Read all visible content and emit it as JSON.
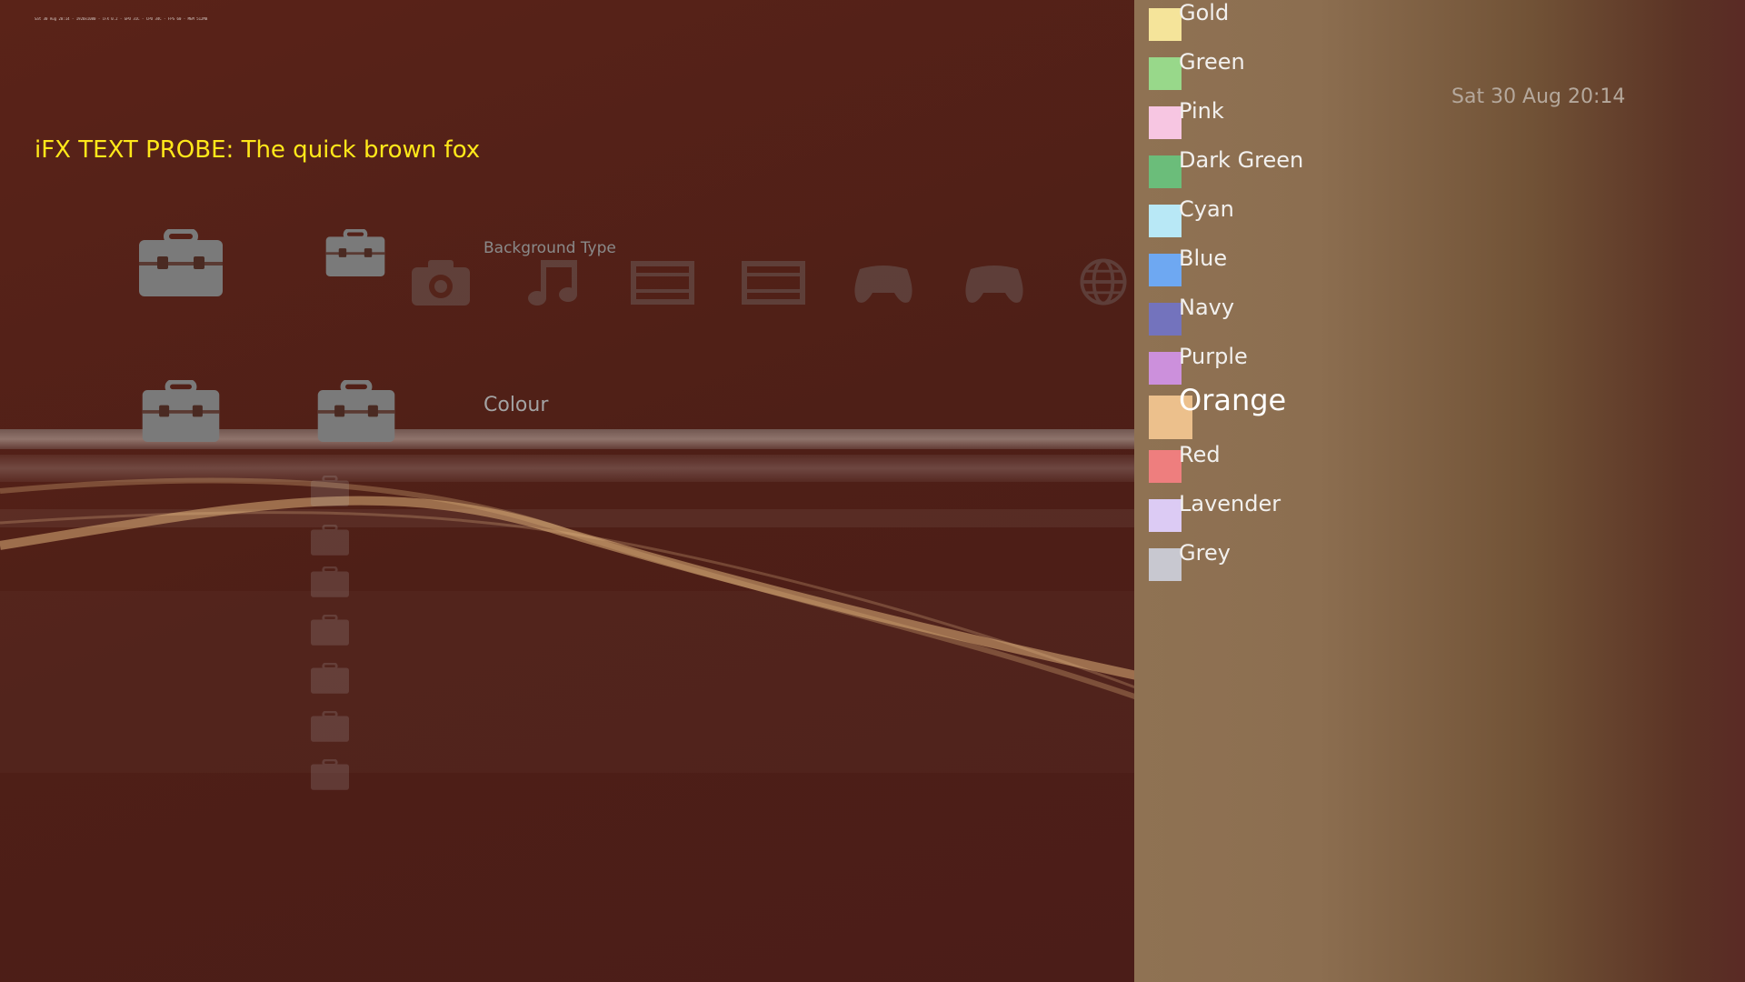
{
  "header": {
    "debug_text": "Sat 30 Aug 20:14 - 1920x1080 - iFX 0.2 - GPU 31C - CPU 34C - FPS 60 - MEM 512MB",
    "probe_text": "iFX TEXT PROBE: The quick brown fox"
  },
  "clock": {
    "text": "Sat 30 Aug 20:14"
  },
  "xmb": {
    "categories": [
      "toolbox-icon",
      "photo-icon",
      "music-icon",
      "video-icon",
      "video-icon",
      "game-icon",
      "game-icon",
      "network-icon"
    ],
    "labels": {
      "background_type": "Background Type",
      "colour": "Colour"
    }
  },
  "colour_options": {
    "items": [
      {
        "label": "Gold",
        "color": "#f5e49a"
      },
      {
        "label": "Green",
        "color": "#98d88a"
      },
      {
        "label": "Pink",
        "color": "#f7c6e2"
      },
      {
        "label": "Dark Green",
        "color": "#6bbd7a"
      },
      {
        "label": "Cyan",
        "color": "#b8e8f6"
      },
      {
        "label": "Blue",
        "color": "#6ea8f2"
      },
      {
        "label": "Navy",
        "color": "#7373bd"
      },
      {
        "label": "Purple",
        "color": "#cc90dc"
      },
      {
        "label": "Orange",
        "color": "#ecc08c",
        "selected": true
      },
      {
        "label": "Red",
        "color": "#ee7e7e"
      },
      {
        "label": "Lavender",
        "color": "#dccbf4"
      },
      {
        "label": "Grey",
        "color": "#c8c8d0"
      }
    ]
  },
  "colors": {
    "background": "#4e1f17",
    "panel": "#8c6e50",
    "probe_text": "#ffe81a"
  }
}
